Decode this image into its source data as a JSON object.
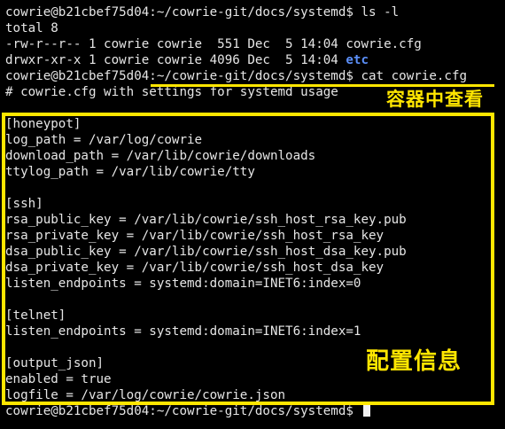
{
  "terminal": {
    "prompt_ls": "cowrie@b21cbef75d04:~/cowrie-git/docs/systemd$ ls -l",
    "total": "total 8",
    "file_line": "-rw-r--r-- 1 cowrie cowrie  551 Dec  5 14:04 cowrie.cfg",
    "dir_line_prefix": "drwxr-xr-x 1 cowrie cowrie 4096 Dec  5 14:04 ",
    "dir_name": "etc",
    "prompt_cat": "cowrie@b21cbef75d04:~/cowrie-git/docs/systemd$ cat cowrie.cfg",
    "comment": "# cowrie.cfg with settings for systemd usage",
    "config_lines": [
      "",
      "[honeypot]",
      "log_path = /var/log/cowrie",
      "download_path = /var/lib/cowrie/downloads",
      "ttylog_path = /var/lib/cowrie/tty",
      "",
      "[ssh]",
      "rsa_public_key = /var/lib/cowrie/ssh_host_rsa_key.pub",
      "rsa_private_key = /var/lib/cowrie/ssh_host_rsa_key",
      "dsa_public_key = /var/lib/cowrie/ssh_host_dsa_key.pub",
      "dsa_private_key = /var/lib/cowrie/ssh_host_dsa_key",
      "listen_endpoints = systemd:domain=INET6:index=0",
      "",
      "[telnet]",
      "listen_endpoints = systemd:domain=INET6:index=1",
      "",
      "[output_json]",
      "enabled = true",
      "logfile = /var/log/cowrie/cowrie.json"
    ],
    "prompt_final": "cowrie@b21cbef75d04:~/cowrie-git/docs/systemd$ "
  },
  "annotations": {
    "container_view_label": "容器中查看",
    "config_info_label": "配置信息"
  },
  "colors": {
    "background": "#000000",
    "text": "#e6e6e6",
    "directory": "#5b8ff9",
    "annotation": "#ffe600"
  }
}
